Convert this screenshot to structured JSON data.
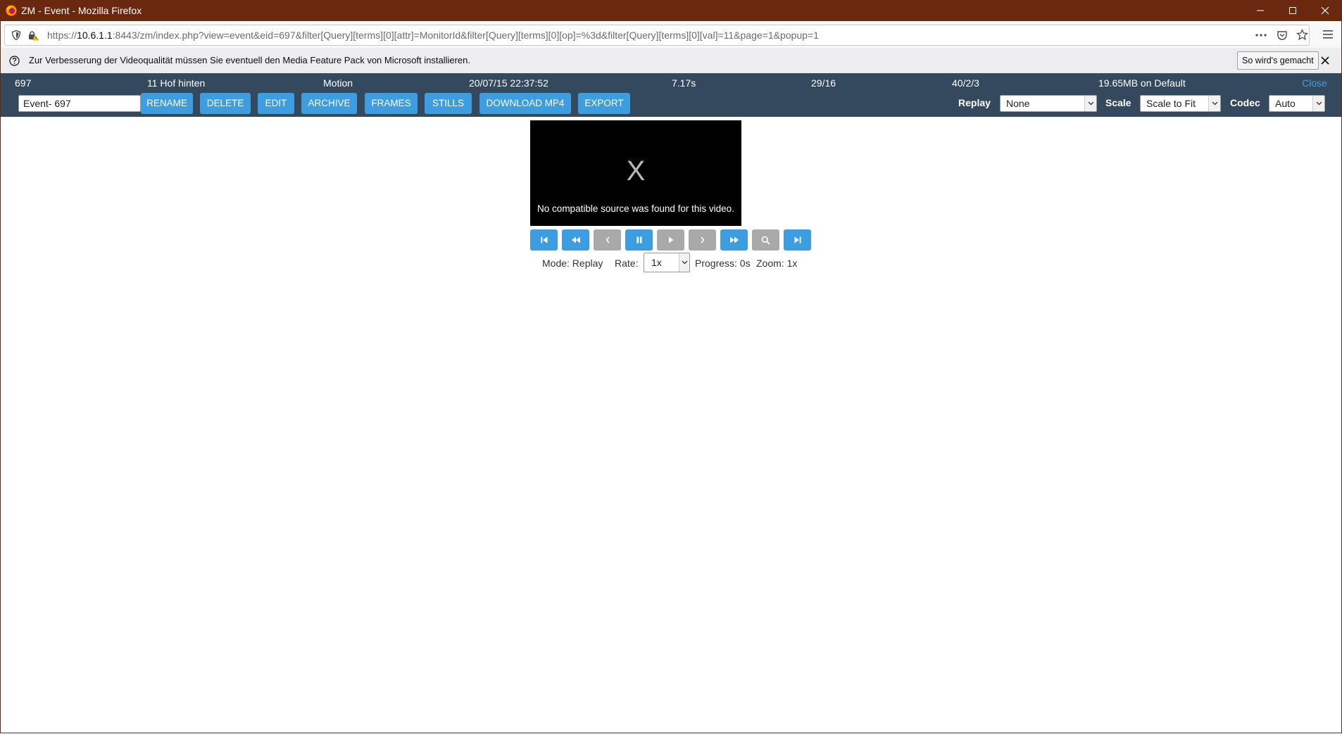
{
  "window": {
    "title": "ZM - Event - Mozilla Firefox"
  },
  "browser": {
    "url_scheme": "https://",
    "url_host": "10.6.1.1",
    "url_rest": ":8443/zm/index.php?view=event&eid=697&filter[Query][terms][0][attr]=MonitorId&filter[Query][terms][0][op]=%3d&filter[Query][terms][0][val]=11&page=1&popup=1"
  },
  "notification": {
    "message": "Zur Verbesserung der Videoqualität müssen Sie eventuell den Media Feature Pack von Microsoft installieren.",
    "button": "So wird's gemacht"
  },
  "event": {
    "id": "697",
    "monitor": "11 Hof hinten",
    "cause": "Motion",
    "time": "20/07/15 22:37:52",
    "duration": "7.17s",
    "frames": "29/16",
    "scores": "40/2/3",
    "size": "19.65MB on Default",
    "close": "Close",
    "name": "Event- 697"
  },
  "actions": {
    "rename": "RENAME",
    "delete": "DELETE",
    "edit": "EDIT",
    "archive": "ARCHIVE",
    "frames": "FRAMES",
    "stills": "STILLS",
    "download": "DOWNLOAD MP4",
    "export": "EXPORT"
  },
  "selectors": {
    "replay_label": "Replay",
    "replay_value": "None",
    "scale_label": "Scale",
    "scale_value": "Scale to Fit",
    "codec_label": "Codec",
    "codec_value": "Auto"
  },
  "video": {
    "placeholder": "X",
    "error": "No compatible source was found for this video."
  },
  "playback": {
    "mode": "Mode: Replay",
    "rate_label": "Rate:",
    "rate_value": "1x",
    "progress": "Progress: 0s",
    "zoom": "Zoom: 1x"
  },
  "colors": {
    "titlebar": "#6a290f",
    "header": "#34495e",
    "button": "#3c9ee0",
    "button_disabled": "#a9a9a9"
  }
}
